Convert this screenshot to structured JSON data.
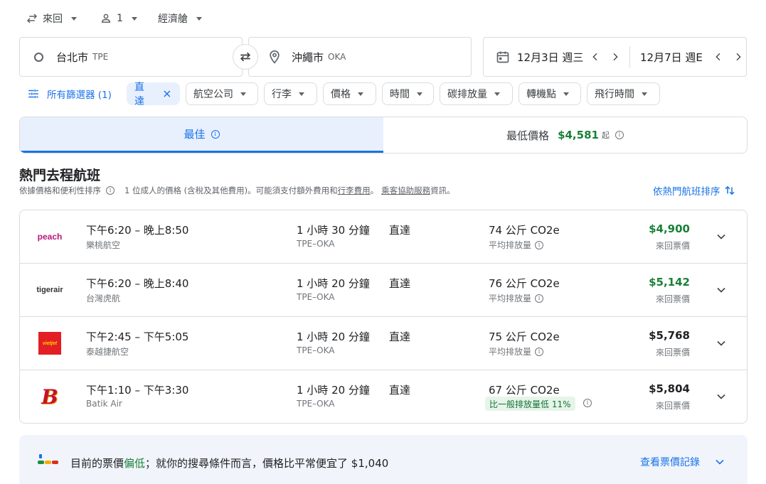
{
  "top_controls": {
    "trip_type": "來回",
    "passengers": "1",
    "cabin": "經濟艙"
  },
  "search": {
    "origin": {
      "city": "台北市",
      "code": "TPE"
    },
    "destination": {
      "city": "沖繩市",
      "code": "OKA"
    },
    "depart_date": "12月3日 週三",
    "return_date": "12月7日 週E"
  },
  "filters": {
    "all_filters": "所有篩選器 (1)",
    "chips": [
      "直達",
      "航空公司",
      "行李",
      "價格",
      "時間",
      "碳排放量",
      "轉機點",
      "飛行時間"
    ]
  },
  "tabs": {
    "best": "最佳",
    "cheapest_label": "最低價格",
    "cheapest_price": "$4,581",
    "cheapest_suffix": "起"
  },
  "results": {
    "title": "熱門去程航班",
    "subtitle_a": "依據價格和便利性排序",
    "subtitle_b": "1 位成人的價格 (含稅及其他費用)。可能須支付額外費用和",
    "subtitle_link1": "行李費用",
    "subtitle_c": "。",
    "subtitle_link2": "乘客協助服務",
    "subtitle_d": "資訊。",
    "sort_label": "依熱門航班排序"
  },
  "flights": [
    {
      "times": "下午6:20 – 晚上8:50",
      "airline": "樂桃航空",
      "duration": "1 小時 30 分鐘",
      "route": "TPE–OKA",
      "stops": "直達",
      "emissions": "74 公斤 CO2e",
      "emissions_note": "平均排放量",
      "price": "$4,900",
      "price_type": "來回票價",
      "logo_text": "peach",
      "logo_color": "#b5177c"
    },
    {
      "times": "下午6:20 – 晚上8:40",
      "airline": "台灣虎航",
      "duration": "1 小時 20 分鐘",
      "route": "TPE–OKA",
      "stops": "直達",
      "emissions": "76 公斤 CO2e",
      "emissions_note": "平均排放量",
      "price": "$5,142",
      "price_type": "來回票價",
      "logo_text": "tigerair",
      "logo_color": "#333333"
    },
    {
      "times": "下午2:45 – 下午5:05",
      "airline": "泰越捷航空",
      "duration": "1 小時 20 分鐘",
      "route": "TPE–OKA",
      "stops": "直達",
      "emissions": "75 公斤 CO2e",
      "emissions_note": "平均排放量",
      "price": "$5,768",
      "price_type": "來回票價",
      "logo_text": "vietjet",
      "logo_color": "#e31e24"
    },
    {
      "times": "下午1:10 – 下午3:30",
      "airline": "Batik Air",
      "duration": "1 小時 20 分鐘",
      "route": "TPE–OKA",
      "stops": "直達",
      "emissions": "67 公斤 CO2e",
      "emissions_note": "比一般排放量低 11%",
      "price": "$5,804",
      "price_type": "來回票價",
      "logo_text": "B",
      "logo_color": "#c8102e"
    }
  ],
  "banner": {
    "text_a": "目前的票價",
    "text_low": "偏低",
    "text_b": "；就你的搜尋條件而言，價格比平常便宜了 $1,040",
    "history_label": "查看票價記錄"
  },
  "colors": {
    "accent": "#1a73e8",
    "green_price": "#188038",
    "active_tab_bg": "#e8f0fe",
    "banner_bg": "#f1f5fb"
  }
}
